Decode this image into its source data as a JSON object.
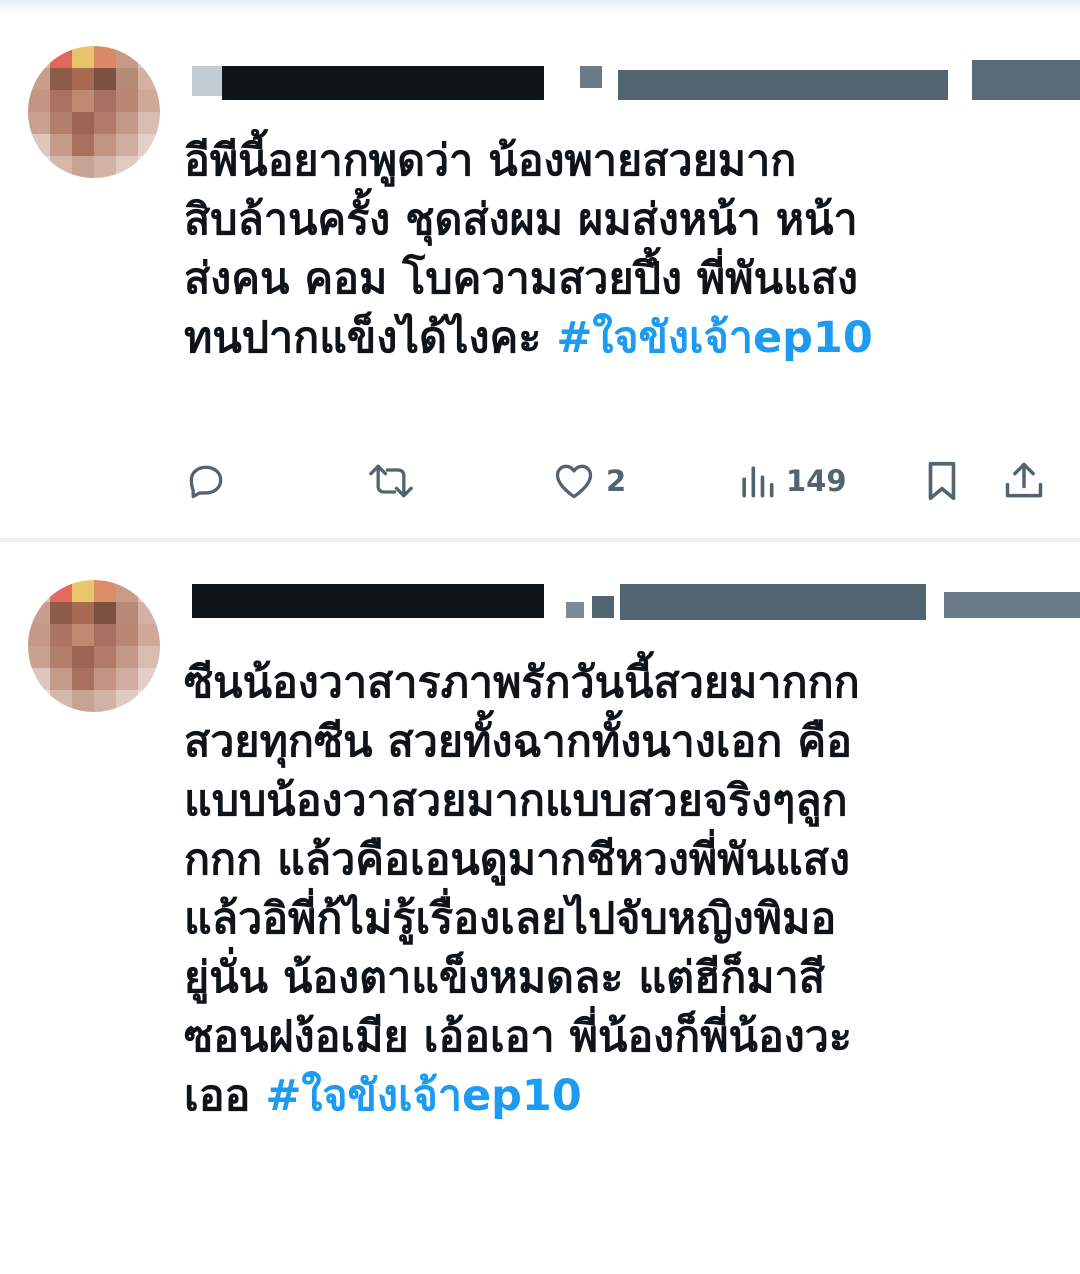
{
  "tweets": [
    {
      "author_name": "",
      "author_handle": "",
      "text": "อีพีนี้อยากพูดว่า น้องพายสวยมาก\nสิบล้านครั้ง ชุดส่งผม ผมส่งหน้า หน้า\nส่งคน คอม โบความสวยปึ้ง พี่พันแสง\nทนปากแข็งได้ไงคะ ",
      "hashtag": "#ใจขังเจ้าep10",
      "actions": {
        "reply_icon": "reply-icon",
        "retweet_icon": "retweet-icon",
        "like_icon": "heart-icon",
        "likes": "2",
        "views_icon": "views-icon",
        "views": "149",
        "bookmark_icon": "bookmark-icon",
        "share_icon": "share-icon"
      }
    },
    {
      "author_name": "",
      "author_handle": "",
      "text": "ซีนน้องวาสารภาพรักวันนี้สวยมากกก\nสวยทุกซีน สวยทั้งฉากทั้งนางเอก คือ\nแบบน้องวาสวยมากแบบสวยจริงๆลูก\nกกก  แล้วคือเอนดูมากชีหวงพี่พันแสง\nแล้วอิพี่ก้ไม่รู้เรื่องเลยไปจับหญิงพิมอ\nยู่นั่น น้องตาแข็งหมดละ แต่ฮีก็มาสี\nซอนฝง้อเมีย เอ้อเอา พี่น้องก็พี่น้องวะ\nเออ ",
      "hashtag": "#ใจขังเจ้าep10"
    }
  ],
  "colors": {
    "text": "#0f1419",
    "hashtag": "#1d9bf0",
    "action": "#536471",
    "divider": "#eff3f4"
  }
}
